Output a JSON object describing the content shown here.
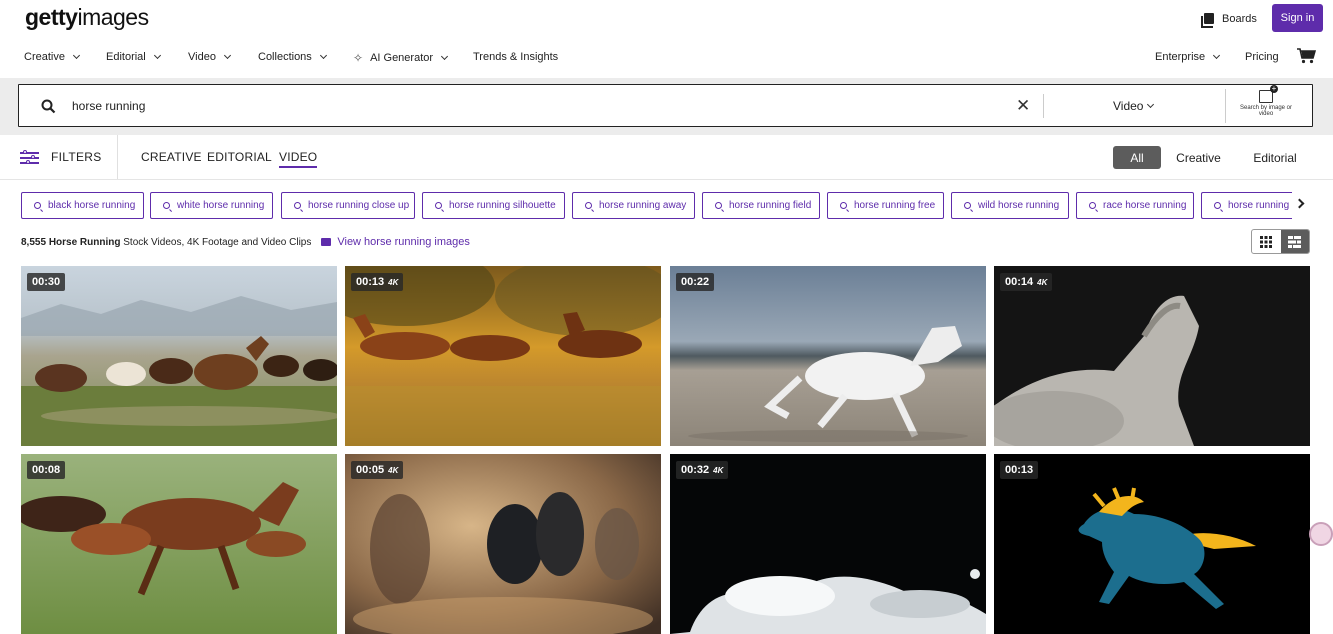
{
  "header": {
    "logo_bold": "getty",
    "logo_light": "images",
    "boards_label": "Boards",
    "signin_label": "Sign in"
  },
  "nav": {
    "items": [
      "Creative",
      "Editorial",
      "Video",
      "Collections",
      "AI Generator",
      "Trends & Insights"
    ],
    "enterprise": "Enterprise",
    "pricing": "Pricing"
  },
  "search": {
    "query": "horse running",
    "type": "Video",
    "image_search_label": "Search by image or video"
  },
  "filters": {
    "label": "FILTERS",
    "tabs": [
      "CREATIVE",
      "EDITORIAL",
      "VIDEO"
    ],
    "active_tab": "VIDEO",
    "segments": [
      "All",
      "Creative",
      "Editorial"
    ],
    "active_segment": "All"
  },
  "related": [
    "black horse running",
    "white horse running",
    "horse running close up",
    "horse running silhouette",
    "horse running away",
    "horse running field",
    "horse running free",
    "wild horse running",
    "race horse running",
    "horse running l"
  ],
  "results": {
    "count": "8,555",
    "term": "Horse Running",
    "suffix": "Stock Videos, 4K Footage and Video Clips",
    "view_images": "View horse running images"
  },
  "videos": [
    {
      "duration": "00:30",
      "badge": ""
    },
    {
      "duration": "00:13",
      "badge": "4K"
    },
    {
      "duration": "00:22",
      "badge": ""
    },
    {
      "duration": "00:14",
      "badge": "4K"
    },
    {
      "duration": "00:08",
      "badge": ""
    },
    {
      "duration": "00:05",
      "badge": "4K"
    },
    {
      "duration": "00:32",
      "badge": "4K"
    },
    {
      "duration": "00:13",
      "badge": ""
    }
  ],
  "colors": {
    "brand": "#5e2cab",
    "toggle_active": "#5c5c5c"
  }
}
